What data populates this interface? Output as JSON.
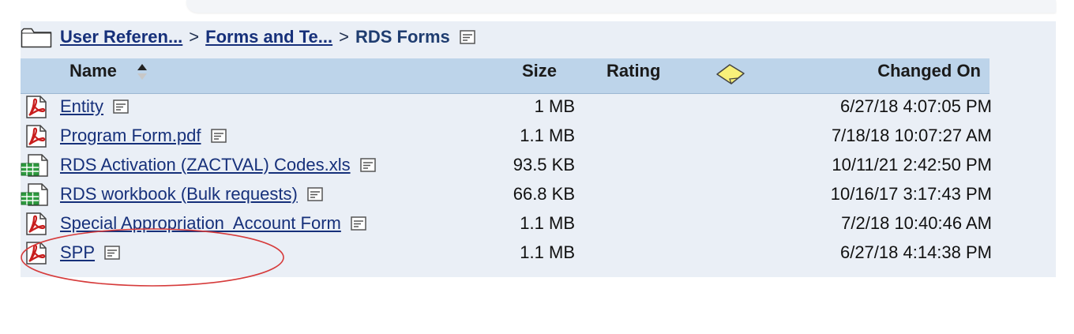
{
  "breadcrumb": {
    "items": [
      "User Referen...",
      "Forms and Te..."
    ],
    "separator": ">",
    "current": "RDS Forms"
  },
  "table": {
    "columns": {
      "name": "Name",
      "size": "Size",
      "rating": "Rating",
      "changed_on": "Changed On"
    },
    "sort": {
      "column": "name",
      "direction": "ascending"
    },
    "rows": [
      {
        "name": "Entity",
        "type": "pdf-icon",
        "size": "1 MB",
        "changed_on": "6/27/18 4:07:05 PM"
      },
      {
        "name": "Program Form.pdf",
        "type": "pdf-icon",
        "size": "1.1 MB",
        "changed_on": "7/18/18 10:07:27 AM"
      },
      {
        "name": "RDS Activation (ZACTVAL) Codes.xls",
        "type": "spreadsheet-icon",
        "size": "93.5 KB",
        "changed_on": "10/11/21 2:42:50 PM"
      },
      {
        "name": "RDS workbook (Bulk requests)",
        "type": "spreadsheet-icon",
        "size": "66.8 KB",
        "changed_on": "10/16/17 3:17:43 PM"
      },
      {
        "name": "Special Appropriation  Account Form",
        "type": "pdf-icon",
        "size": "1.1 MB",
        "changed_on": "7/2/18 10:40:46 AM"
      },
      {
        "name": "SPP",
        "type": "pdf-icon",
        "size": "1.1 MB",
        "changed_on": "6/27/18 4:14:38 PM"
      }
    ]
  },
  "icons": {
    "folder": "folder-icon",
    "note": "properties-note-icon",
    "sort": "sort-ascending-icon",
    "comments": "sticky-note-icon"
  },
  "colors": {
    "link": "#16307a",
    "header_bg": "#bdd4ea",
    "panel_bg": "#eaeff6",
    "annotation": "#d63b3b"
  }
}
